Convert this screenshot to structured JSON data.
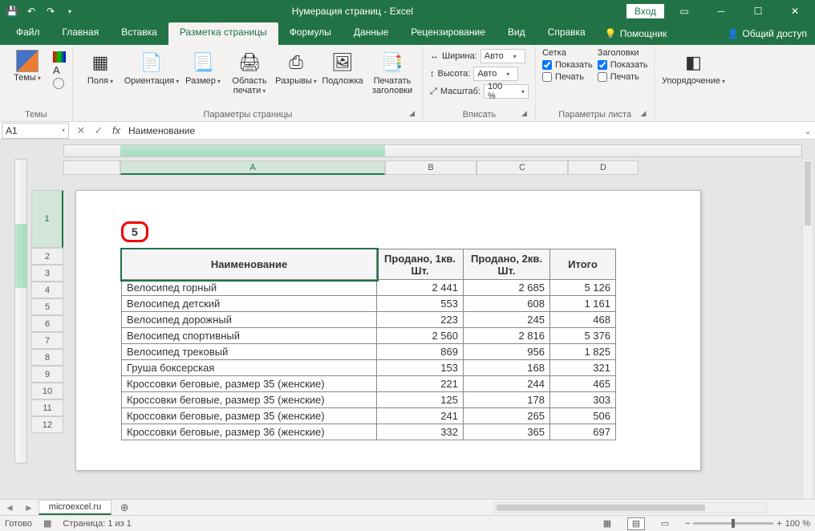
{
  "titlebar": {
    "title": "Нумерация страниц - Excel",
    "signin": "Вход"
  },
  "tabs": {
    "file": "Файл",
    "home": "Главная",
    "insert": "Вставка",
    "pagelayout": "Разметка страницы",
    "formulas": "Формулы",
    "data": "Данные",
    "review": "Рецензирование",
    "view": "Вид",
    "help": "Справка",
    "assistant": "Помощник",
    "share": "Общий доступ"
  },
  "ribbon": {
    "themes": {
      "btn": "Темы",
      "label": "Темы"
    },
    "pagesetup": {
      "margins": "Поля",
      "orientation": "Ориентация",
      "size": "Размер",
      "printarea": "Область печати",
      "breaks": "Разрывы",
      "background": "Подложка",
      "printtitles": "Печатать заголовки",
      "label": "Параметры страницы"
    },
    "scale": {
      "width_lbl": "Ширина:",
      "width_val": "Авто",
      "height_lbl": "Высота:",
      "height_val": "Авто",
      "scale_lbl": "Масштаб:",
      "scale_val": "100 %",
      "label": "Вписать"
    },
    "sheetopts": {
      "grid_hdr": "Сетка",
      "headings_hdr": "Заголовки",
      "show": "Показать",
      "print": "Печать",
      "label": "Параметры листа"
    },
    "arrange": {
      "btn": "Упорядочение",
      "label": ""
    }
  },
  "fbar": {
    "namebox": "A1",
    "formula": "Наименование"
  },
  "page": {
    "number": "5"
  },
  "table": {
    "headers": [
      "Наименование",
      "Продано, 1кв. Шт.",
      "Продано, 2кв. Шт.",
      "Итого"
    ],
    "rows": [
      [
        "Велосипед горный",
        "2 441",
        "2 685",
        "5 126"
      ],
      [
        "Велосипед детский",
        "553",
        "608",
        "1 161"
      ],
      [
        "Велосипед дорожный",
        "223",
        "245",
        "468"
      ],
      [
        "Велосипед спортивный",
        "2 560",
        "2 816",
        "5 376"
      ],
      [
        "Велосипед трековый",
        "869",
        "956",
        "1 825"
      ],
      [
        "Груша боксерская",
        "153",
        "168",
        "321"
      ],
      [
        "Кроссовки беговые, размер 35 (женские)",
        "221",
        "244",
        "465"
      ],
      [
        "Кроссовки беговые, размер 35 (женские)",
        "125",
        "178",
        "303"
      ],
      [
        "Кроссовки беговые, размер 35 (женские)",
        "241",
        "265",
        "506"
      ],
      [
        "Кроссовки беговые, размер 36 (женские)",
        "332",
        "365",
        "697"
      ]
    ]
  },
  "colheaders": [
    "A",
    "B",
    "C",
    "D"
  ],
  "rowheaders": [
    "1",
    "2",
    "3",
    "4",
    "5",
    "6",
    "7",
    "8",
    "9",
    "10",
    "11",
    "12"
  ],
  "sheettab": "microexcel.ru",
  "status": {
    "ready": "Готово",
    "page": "Страница: 1 из 1",
    "zoom": "100 %"
  }
}
